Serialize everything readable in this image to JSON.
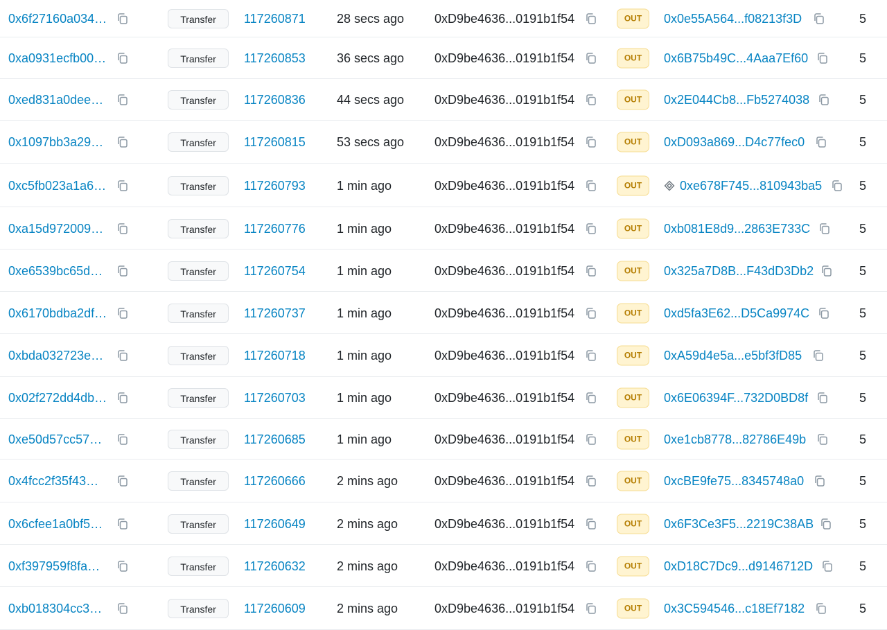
{
  "colors": {
    "link": "#0784c3",
    "text": "#212529",
    "out_badge_bg": "#fff4d1",
    "out_badge_text": "#b47d00"
  },
  "icons": {
    "copy": "copy-icon",
    "contract": "contract-icon"
  },
  "rows": [
    {
      "hash": "0x6f27160a034…",
      "method": "Transfer",
      "block": "117260871",
      "age": "28 secs ago",
      "from": "0xD9be4636...0191b1f54",
      "direction": "OUT",
      "to": "0x0e55A564...f08213f3D",
      "to_is_contract": false,
      "value": "5"
    },
    {
      "hash": "0xa0931ecfb00…",
      "method": "Transfer",
      "block": "117260853",
      "age": "36 secs ago",
      "from": "0xD9be4636...0191b1f54",
      "direction": "OUT",
      "to": "0x6B75b49C...4Aaa7Ef60",
      "to_is_contract": false,
      "value": "5"
    },
    {
      "hash": "0xed831a0dee…",
      "method": "Transfer",
      "block": "117260836",
      "age": "44 secs ago",
      "from": "0xD9be4636...0191b1f54",
      "direction": "OUT",
      "to": "0x2E044Cb8...Fb5274038",
      "to_is_contract": false,
      "value": "5"
    },
    {
      "hash": "0x1097bb3a29…",
      "method": "Transfer",
      "block": "117260815",
      "age": "53 secs ago",
      "from": "0xD9be4636...0191b1f54",
      "direction": "OUT",
      "to": "0xD093a869...D4c77fec0",
      "to_is_contract": false,
      "value": "5"
    },
    {
      "hash": "0xc5fb023a1a6…",
      "method": "Transfer",
      "block": "117260793",
      "age": "1 min ago",
      "from": "0xD9be4636...0191b1f54",
      "direction": "OUT",
      "to": "0xe678F745...810943ba5",
      "to_is_contract": true,
      "value": "5"
    },
    {
      "hash": "0xa15d972009…",
      "method": "Transfer",
      "block": "117260776",
      "age": "1 min ago",
      "from": "0xD9be4636...0191b1f54",
      "direction": "OUT",
      "to": "0xb081E8d9...2863E733C",
      "to_is_contract": false,
      "value": "5"
    },
    {
      "hash": "0xe6539bc65d…",
      "method": "Transfer",
      "block": "117260754",
      "age": "1 min ago",
      "from": "0xD9be4636...0191b1f54",
      "direction": "OUT",
      "to": "0x325a7D8B...F43dD3Db2",
      "to_is_contract": false,
      "value": "5"
    },
    {
      "hash": "0x6170bdba2df…",
      "method": "Transfer",
      "block": "117260737",
      "age": "1 min ago",
      "from": "0xD9be4636...0191b1f54",
      "direction": "OUT",
      "to": "0xd5fa3E62...D5Ca9974C",
      "to_is_contract": false,
      "value": "5"
    },
    {
      "hash": "0xbda032723e…",
      "method": "Transfer",
      "block": "117260718",
      "age": "1 min ago",
      "from": "0xD9be4636...0191b1f54",
      "direction": "OUT",
      "to": "0xA59d4e5a...e5bf3fD85",
      "to_is_contract": false,
      "value": "5"
    },
    {
      "hash": "0x02f272dd4db…",
      "method": "Transfer",
      "block": "117260703",
      "age": "1 min ago",
      "from": "0xD9be4636...0191b1f54",
      "direction": "OUT",
      "to": "0x6E06394F...732D0BD8f",
      "to_is_contract": false,
      "value": "5"
    },
    {
      "hash": "0xe50d57cc57…",
      "method": "Transfer",
      "block": "117260685",
      "age": "1 min ago",
      "from": "0xD9be4636...0191b1f54",
      "direction": "OUT",
      "to": "0xe1cb8778...82786E49b",
      "to_is_contract": false,
      "value": "5"
    },
    {
      "hash": "0x4fcc2f35f43…",
      "method": "Transfer",
      "block": "117260666",
      "age": "2 mins ago",
      "from": "0xD9be4636...0191b1f54",
      "direction": "OUT",
      "to": "0xcBE9fe75...8345748a0",
      "to_is_contract": false,
      "value": "5"
    },
    {
      "hash": "0x6cfee1a0bf5…",
      "method": "Transfer",
      "block": "117260649",
      "age": "2 mins ago",
      "from": "0xD9be4636...0191b1f54",
      "direction": "OUT",
      "to": "0x6F3Ce3F5...2219C38AB",
      "to_is_contract": false,
      "value": "5"
    },
    {
      "hash": "0xf397959f8fa…",
      "method": "Transfer",
      "block": "117260632",
      "age": "2 mins ago",
      "from": "0xD9be4636...0191b1f54",
      "direction": "OUT",
      "to": "0xD18C7Dc9...d9146712D",
      "to_is_contract": false,
      "value": "5"
    },
    {
      "hash": "0xb018304cc3…",
      "method": "Transfer",
      "block": "117260609",
      "age": "2 mins ago",
      "from": "0xD9be4636...0191b1f54",
      "direction": "OUT",
      "to": "0x3C594546...c18Ef7182",
      "to_is_contract": false,
      "value": "5"
    }
  ]
}
